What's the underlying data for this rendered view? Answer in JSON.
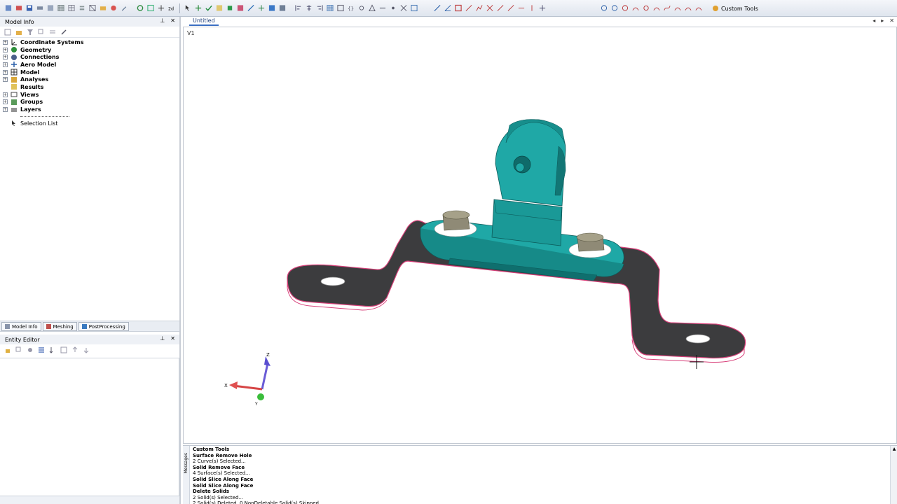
{
  "toolbar": {
    "custom_tools_label": "Custom Tools"
  },
  "model_info": {
    "title": "Model Info",
    "tree": [
      {
        "label": "Coordinate Systems",
        "icon": "coordinate-axes-icon"
      },
      {
        "label": "Geometry",
        "icon": "geometry-icon"
      },
      {
        "label": "Connections",
        "icon": "connections-icon"
      },
      {
        "label": "Aero Model",
        "icon": "aero-model-icon"
      },
      {
        "label": "Model",
        "icon": "model-grid-icon"
      },
      {
        "label": "Analyses",
        "icon": "analyses-icon"
      },
      {
        "label": "Results",
        "icon": "results-icon"
      },
      {
        "label": "Views",
        "icon": "views-icon"
      },
      {
        "label": "Groups",
        "icon": "groups-icon"
      },
      {
        "label": "Layers",
        "icon": "layers-icon"
      }
    ],
    "selection_list": "Selection List"
  },
  "panel_tabs": [
    "Model Info",
    "Meshing",
    "PostProcessing"
  ],
  "entity_editor": {
    "title": "Entity Editor"
  },
  "document": {
    "tab_title": "Untitled",
    "view_label": "V1"
  },
  "triad": {
    "z": "Z",
    "x": "X",
    "y": "Y"
  },
  "messages": {
    "side_label": "Messages",
    "lines": [
      {
        "text": "Custom Tools",
        "bold": true
      },
      {
        "text": "Surface Remove Hole",
        "bold": true
      },
      {
        "text": "2 Curve(s) Selected...",
        "bold": false
      },
      {
        "text": "Solid Remove Face",
        "bold": true
      },
      {
        "text": "4 Surface(s) Selected...",
        "bold": false
      },
      {
        "text": "Solid Slice Along Face",
        "bold": true
      },
      {
        "text": "Solid Slice Along Face",
        "bold": true
      },
      {
        "text": "Delete Solids",
        "bold": true
      },
      {
        "text": "2 Solid(s) Selected...",
        "bold": false
      },
      {
        "text": "2 Solid(s) Deleted, 0 NonDeletable Solid(s) Skipped",
        "bold": false
      }
    ]
  },
  "colors": {
    "teal_part": "#1fa8a6",
    "dark_plate": "#3d3d3f",
    "edge_pink": "#d8407a",
    "bolt": "#8f8a76"
  }
}
